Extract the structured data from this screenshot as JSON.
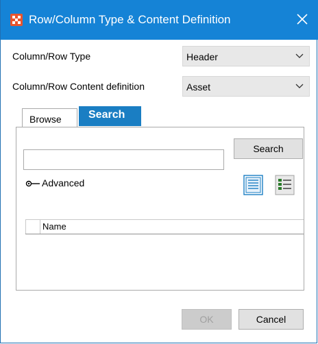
{
  "window": {
    "title": "Row/Column Type & Content Definition",
    "close_icon": "close-icon",
    "app_icon": "app-grid-icon",
    "accent_color": "#1583d6"
  },
  "form": {
    "type_label": "Column/Row Type",
    "type_value": "Header",
    "content_label": "Column/Row Content definition",
    "content_value": "Asset"
  },
  "tabs": [
    {
      "label": "Browse",
      "active": false
    },
    {
      "label": "Search",
      "active": true
    }
  ],
  "search": {
    "query": "",
    "button_label": "Search",
    "advanced_label": "Advanced",
    "view_icons": [
      "list-view-icon",
      "detail-view-icon"
    ]
  },
  "results": {
    "columns": [
      "Name"
    ],
    "rows": []
  },
  "footer": {
    "ok_label": "OK",
    "ok_enabled": false,
    "cancel_label": "Cancel"
  }
}
